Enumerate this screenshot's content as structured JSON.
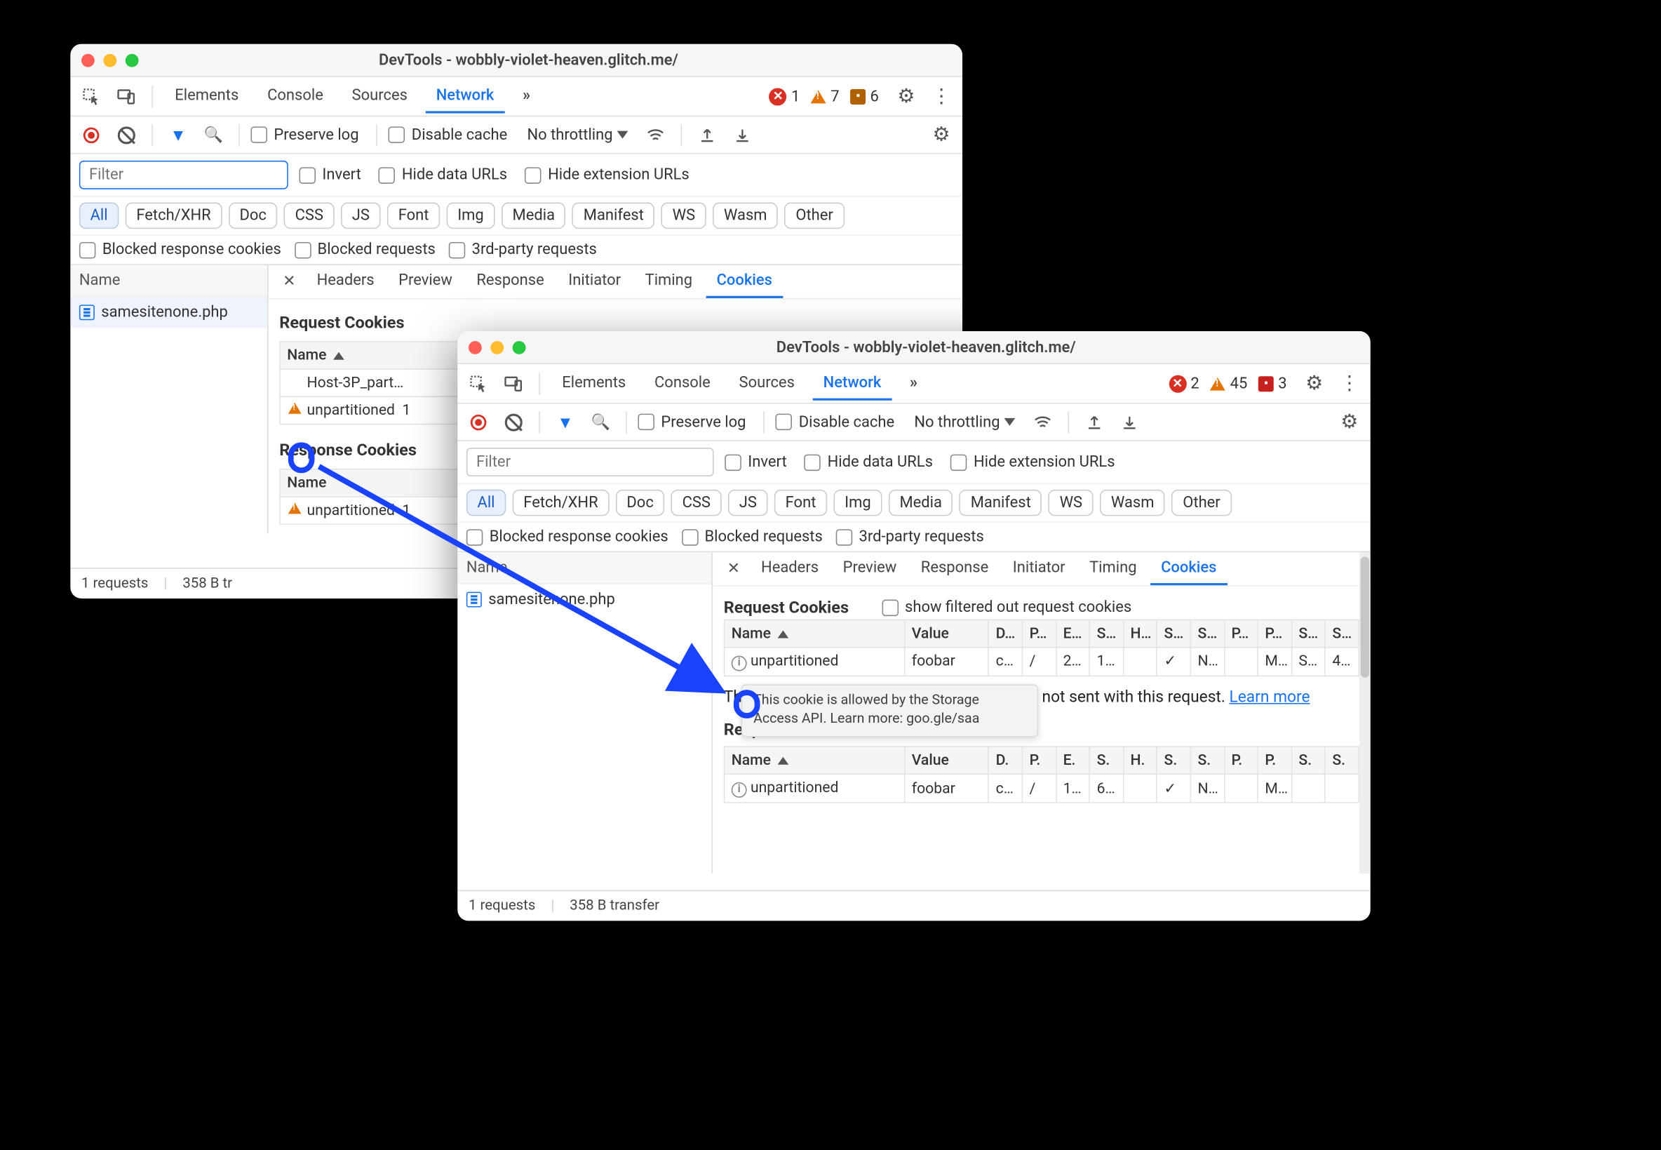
{
  "app": {
    "title_a": "DevTools - wobbly-violet-heaven.glitch.me/",
    "title_b": "DevTools - wobbly-violet-heaven.glitch.me/"
  },
  "tabs": {
    "elements": "Elements",
    "console": "Console",
    "sources": "Sources",
    "network": "Network",
    "more": "»"
  },
  "counts_a": {
    "errors": "1",
    "warnings": "7",
    "issues": "6"
  },
  "counts_b": {
    "errors": "2",
    "warnings": "45",
    "issues": "3"
  },
  "net_toolbar": {
    "preserve_log": "Preserve log",
    "disable_cache": "Disable cache",
    "throttling": "No throttling"
  },
  "filter": {
    "placeholder": "Filter",
    "invert": "Invert",
    "hide_data": "Hide data URLs",
    "hide_ext": "Hide extension URLs"
  },
  "types": {
    "all": "All",
    "fetch": "Fetch/XHR",
    "doc": "Doc",
    "css": "CSS",
    "js": "JS",
    "font": "Font",
    "img": "Img",
    "media": "Media",
    "manifest": "Manifest",
    "ws": "WS",
    "wasm": "Wasm",
    "other": "Other"
  },
  "extra_filters": {
    "blocked_cookies": "Blocked response cookies",
    "blocked_req": "Blocked requests",
    "third_party": "3rd-party requests"
  },
  "sidebar": {
    "header": "Name",
    "file": "samesitenone.php"
  },
  "detail_tabs": {
    "headers": "Headers",
    "preview": "Preview",
    "response": "Response",
    "initiator": "Initiator",
    "timing": "Timing",
    "cookies": "Cookies"
  },
  "win_a": {
    "req_title": "Request Cookies",
    "resp_title": "Response Cookies",
    "name_col": "Name",
    "req_rows": [
      {
        "name": "Host-3P_part…"
      },
      {
        "name": "unpartitioned",
        "warn": true
      }
    ],
    "resp_rows": [
      {
        "name": "unpartitioned",
        "warn": true
      }
    ],
    "status_req": "1 requests",
    "status_size": "358 B tr"
  },
  "win_b": {
    "req_title": "Request Cookies",
    "show_filtered": "show filtered out request cookies",
    "cols": [
      "Name",
      "Value",
      "D…",
      "P…",
      "E…",
      "S…",
      "H…",
      "S…",
      "S…",
      "P…",
      "P…",
      "S…",
      "S…"
    ],
    "req_row": {
      "name": "unpartitioned",
      "value": "foobar",
      "d": "c…",
      "p": "/",
      "e": "2…",
      "s1": "1…",
      "h": "",
      "s2": "✓",
      "s3": "N…",
      "p1": "",
      "p2": "M…",
      "s4": "S…",
      "s5": "4…"
    },
    "tooltip": "This cookie is allowed by the Storage Access API. Learn more: goo.gle/saa",
    "excl_line_pre": "Thi",
    "excl_line_post": "n, that were not sent with this request. ",
    "learn_more": "Learn more",
    "resp_title": "Response Cookies",
    "resp_cols": [
      "Name",
      "Value",
      "D.",
      "P.",
      "E.",
      "S.",
      "H.",
      "S.",
      "S.",
      "P.",
      "P.",
      "S.",
      "S."
    ],
    "resp_row": {
      "name": "unpartitioned",
      "value": "foobar",
      "d": "c…",
      "p": "/",
      "e": "1…",
      "s1": "6…",
      "h": "",
      "s2": "✓",
      "s3": "N…",
      "p1": "",
      "p2": "M…",
      "s4": "",
      "s5": ""
    },
    "status_req": "1 requests",
    "status_size": "358 B transfer"
  }
}
